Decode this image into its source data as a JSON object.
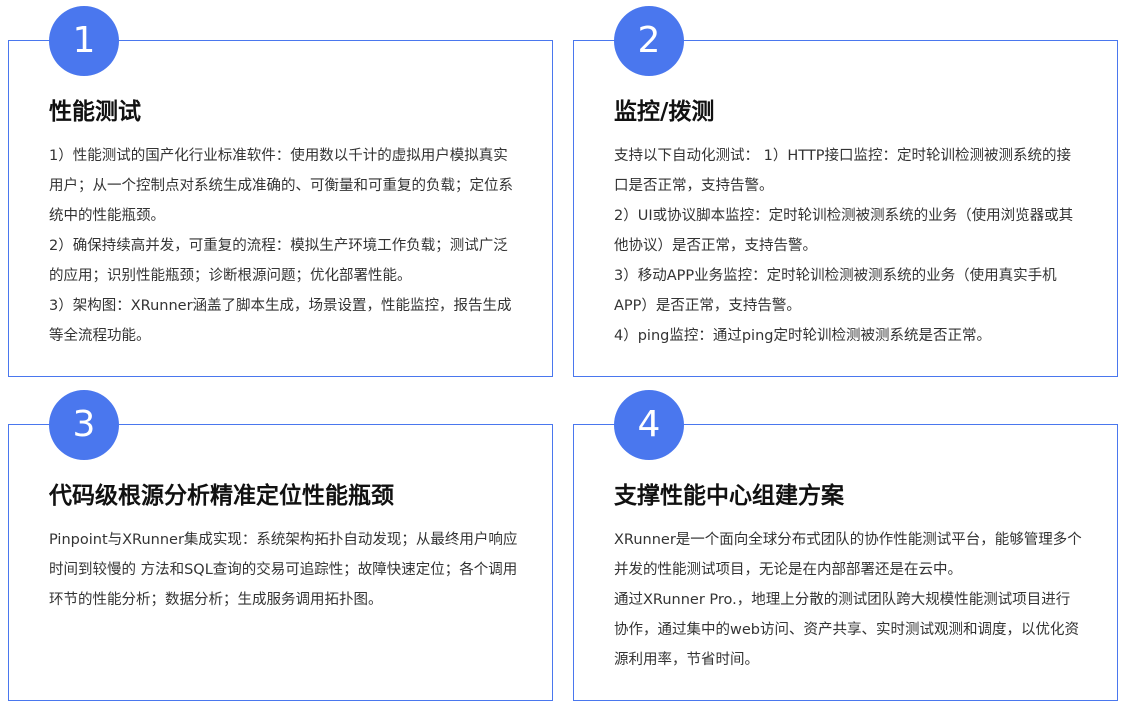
{
  "cards": [
    {
      "number": "1",
      "title": "性能测试",
      "paragraphs": [
        "1）性能测试的国产化行业标准软件：使用数以千计的虚拟用户模拟真实用户；从一个控制点对系统生成准确的、可衡量和可重复的负载；定位系统中的性能瓶颈。",
        "2）确保持续高并发，可重复的流程：模拟生产环境工作负载；测试广泛的应用；识别性能瓶颈；诊断根源问题；优化部署性能。",
        "3）架构图：XRunner涵盖了脚本生成，场景设置，性能监控，报告生成等全流程功能。"
      ]
    },
    {
      "number": "2",
      "title": "监控/拨测",
      "paragraphs": [
        "支持以下自动化测试： 1）HTTP接口监控：定时轮训检测被测系统的接口是否正常，支持告警。",
        "2）UI或协议脚本监控：定时轮训检测被测系统的业务（使用浏览器或其他协议）是否正常，支持告警。",
        "3）移动APP业务监控：定时轮训检测被测系统的业务（使用真实手机APP）是否正常，支持告警。",
        "4）ping监控：通过ping定时轮训检测被测系统是否正常。"
      ]
    },
    {
      "number": "3",
      "title": "代码级根源分析精准定位性能瓶颈",
      "paragraphs": [
        "Pinpoint与XRunner集成实现：系统架构拓扑自动发现；从最终用户响应时间到较慢的 方法和SQL查询的交易可追踪性；故障快速定位；各个调用环节的性能分析；数据分析；生成服务调用拓扑图。"
      ]
    },
    {
      "number": "4",
      "title": "支撑性能中心组建方案",
      "paragraphs": [
        "XRunner是一个面向全球分布式团队的协作性能测试平台，能够管理多个并发的性能测试项目，无论是在内部部署还是在云中。",
        "通过XRunner Pro.，地理上分散的测试团队跨大规模性能测试项目进行协作，通过集中的web访问、资产共享、实时测试观测和调度，以优化资源利用率，节省时间。"
      ]
    }
  ],
  "colors": {
    "accent": "#4a77ee",
    "title": "#111111",
    "text": "#333333"
  }
}
